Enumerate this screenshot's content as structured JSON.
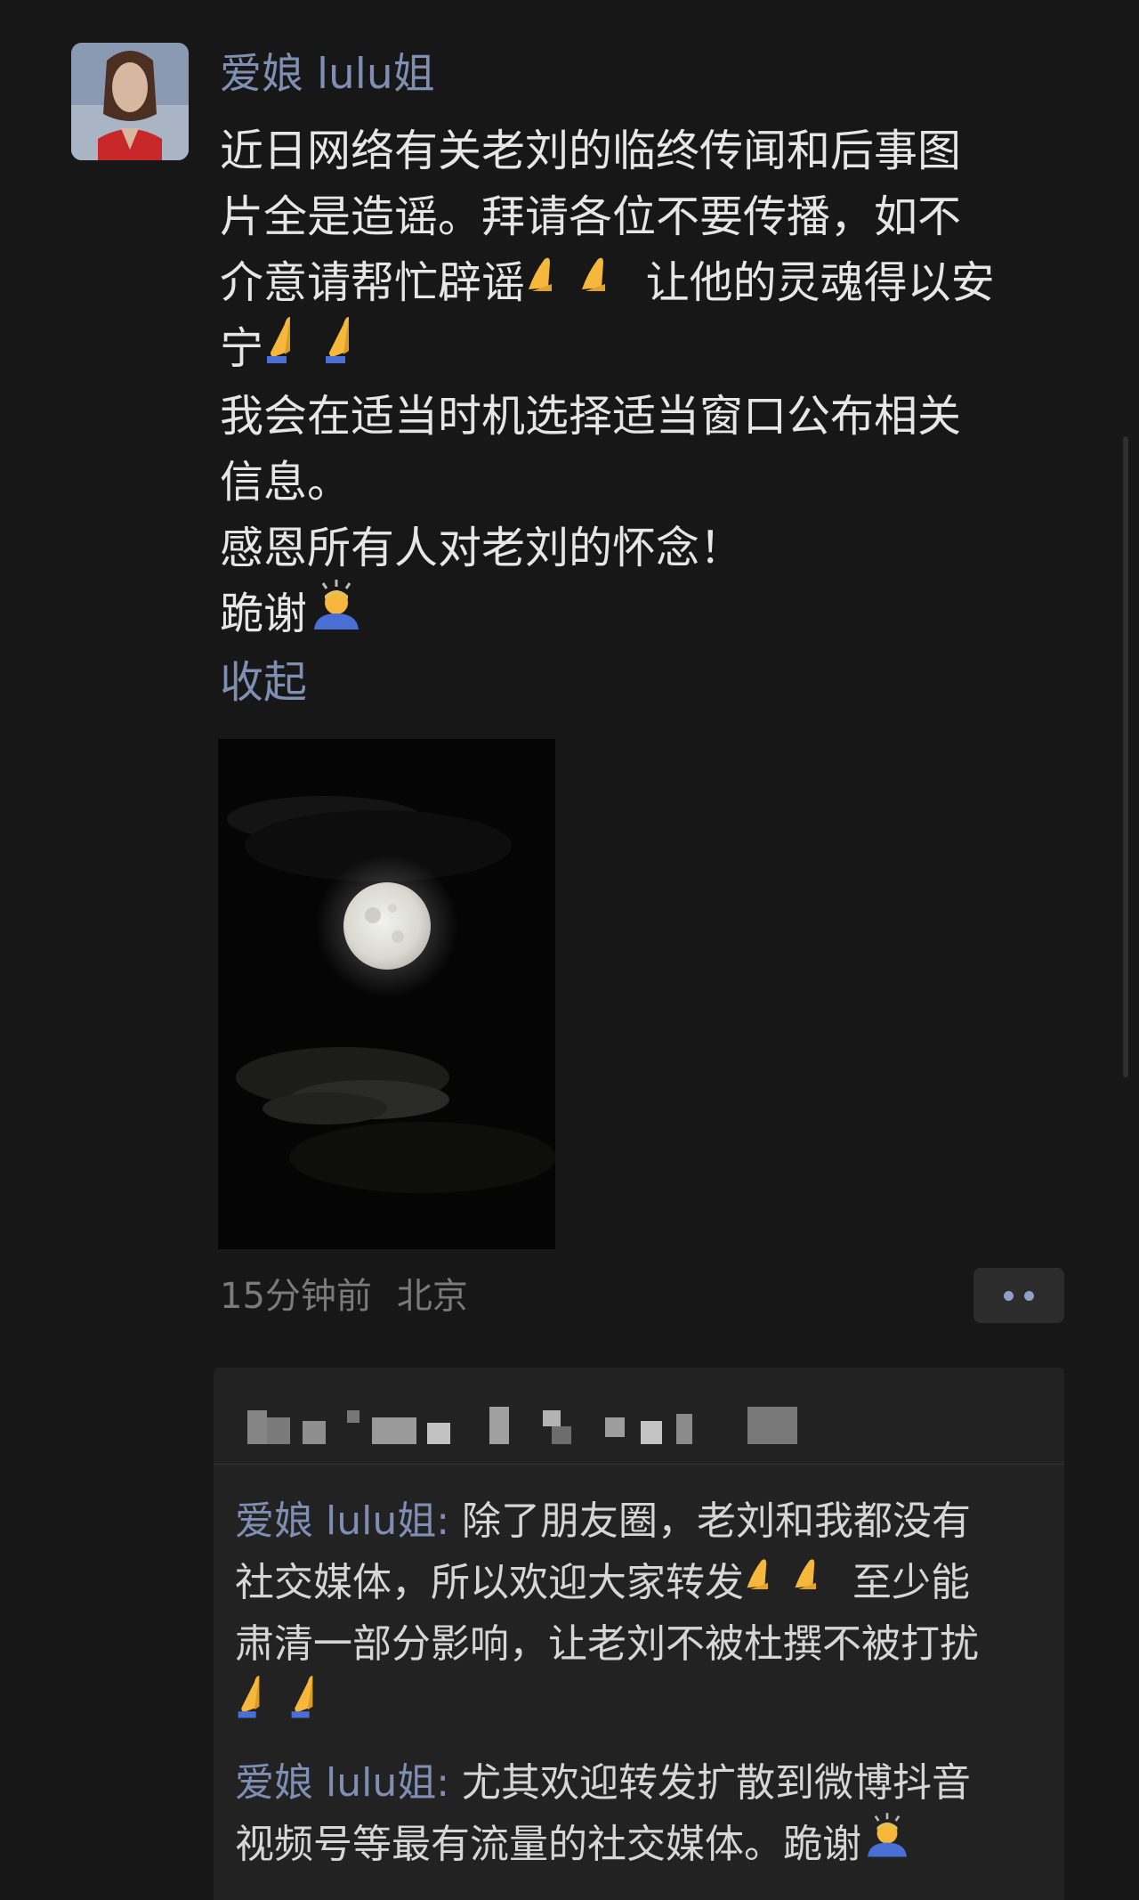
{
  "post": {
    "author": "爱娘 lulu姐",
    "lines": [
      "近日网络有关老刘的临终传闻和后事图",
      "片全是造谣。拜请各位不要传播，如不",
      "介意请帮忙辟谣",
      " 让他的灵魂得以安",
      "宁",
      "我会在适当时机选择适当窗口公布相关",
      "信息。",
      "感恩所有人对老刘的怀念！",
      "跪谢"
    ],
    "collapse_label": "收起",
    "time": "15分钟前",
    "location": "北京"
  },
  "comments": [
    {
      "author": "爱娘 lulu姐",
      "separator": ": ",
      "lines": [
        "除了朋友圈，老刘和我都没有",
        "社交媒体，所以欢迎大家转发",
        " 至少能",
        "肃清一部分影响，让老刘不被杜撰不被打扰"
      ]
    },
    {
      "author": "爱娘 lulu姐",
      "separator": ": ",
      "lines": [
        "尤其欢迎转发扩散到微博抖音",
        "视频号等最有流量的社交媒体。跪谢"
      ]
    }
  ],
  "icons": {
    "avatar": "woman-profile-avatar",
    "more": "more-dots-icon",
    "emoji_palms": "palms-together-emoji",
    "emoji_pray": "folded-hands-emoji",
    "emoji_bow": "bowing-person-emoji"
  },
  "colors": {
    "background": "#171717",
    "link": "#7f8fb3",
    "text": "#e6e6e6",
    "comment_bg": "#222222"
  }
}
